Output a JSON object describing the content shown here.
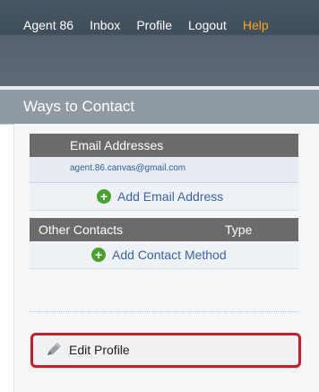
{
  "nav": {
    "items": [
      {
        "label": "Agent 86",
        "name": "nav-agent-86"
      },
      {
        "label": "Inbox",
        "name": "nav-inbox"
      },
      {
        "label": "Profile",
        "name": "nav-profile"
      },
      {
        "label": "Logout",
        "name": "nav-logout"
      },
      {
        "label": "Help",
        "name": "nav-help"
      }
    ],
    "help_color": "#f5a623"
  },
  "section": {
    "title": "Ways to Contact"
  },
  "email": {
    "header": "Email Addresses",
    "address": "agent.86.canvas@gmail.com",
    "add_label": "Add Email Address",
    "add_icon": "plus-circle-icon"
  },
  "contacts": {
    "header_col1": "Other Contacts",
    "header_col2": "Type",
    "add_label": "Add Contact Method",
    "add_icon": "plus-circle-icon"
  },
  "edit": {
    "label": "Edit Profile",
    "icon": "pencil-icon",
    "highlight_color": "#c0202a"
  }
}
